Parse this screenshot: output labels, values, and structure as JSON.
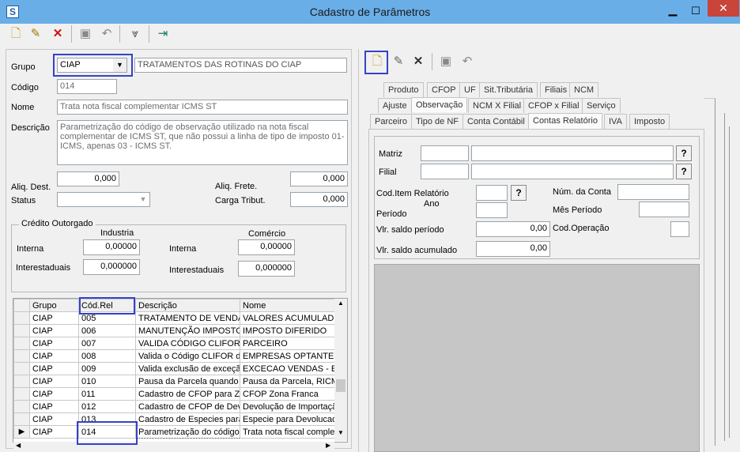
{
  "window": {
    "title": "Cadastro de Parâmetros"
  },
  "toolbar": {
    "buttons": [
      {
        "name": "new-icon",
        "glyph": "🗋"
      },
      {
        "name": "edit-icon",
        "glyph": "✎"
      },
      {
        "name": "delete-icon",
        "glyph": "✕"
      },
      {
        "name": "save-icon",
        "glyph": "💾"
      },
      {
        "name": "undo-icon",
        "glyph": "↶"
      },
      {
        "name": "filter-icon",
        "glyph": "⌨"
      },
      {
        "name": "exit-icon",
        "glyph": "⇥"
      }
    ]
  },
  "form": {
    "grupo_label": "Grupo",
    "grupo_value": "CIAP",
    "grupo_desc": "TRATAMENTOS DAS ROTINAS DO CIAP",
    "codigo_label": "Código",
    "codigo_value": "014",
    "nome_label": "Nome",
    "nome_value": "Trata nota fiscal complementar ICMS ST",
    "descricao_label": "Descrição",
    "descricao_value": "Parametrização do código de observação utilizado na nota fiscal complementar de ICMS ST, que não possui a linha de tipo de imposto 01-ICMS, apenas 03 - ICMS ST.",
    "aliq_dest_label": "Aliq. Dest.",
    "aliq_dest_value": "0,000",
    "aliq_frete_label": "Aliq. Frete.",
    "aliq_frete_value": "0,000",
    "status_label": "Status",
    "carga_label": "Carga Tribut.",
    "carga_value": "0,000",
    "credito": {
      "title": "Crédito Outorgado",
      "industria": "Industria",
      "comercio": "Comércio",
      "interna": "Interna",
      "interestaduais": "Interestaduais",
      "ind_interna": "0,00000",
      "ind_inter": "0,000000",
      "com_interna": "0,00000",
      "com_inter": "0,000000"
    }
  },
  "grid": {
    "columns": [
      "Grupo",
      "Cód.Rel",
      "Descrição",
      "Nome"
    ],
    "rows": [
      [
        "CIAP",
        "005",
        "TRATAMENTO DE VENDAS",
        "VALORES ACUMULADOS"
      ],
      [
        "CIAP",
        "006",
        "MANUTENÇÃO IMPOSTO D",
        "IMPOSTO DIFERIDO"
      ],
      [
        "CIAP",
        "007",
        "VALIDA CÓDIGO CLIFOR E",
        "PARCEIRO"
      ],
      [
        "CIAP",
        "008",
        "Valida o Código CLIFOR de",
        "EMPRESAS OPTANTES P"
      ],
      [
        "CIAP",
        "009",
        "Valida exclusão de exceçã",
        "EXCECAO VENDAS - EXC"
      ],
      [
        "CIAP",
        "010",
        "Pausa da Parcela quando r",
        "Pausa da Parcela, RICMS"
      ],
      [
        "CIAP",
        "011",
        "Cadastro de CFOP para Zo",
        "CFOP Zona Franca"
      ],
      [
        "CIAP",
        "012",
        "Cadastro de CFOP de Dev",
        "Devolução de Importaçã"
      ],
      [
        "CIAP",
        "013",
        "Cadastro de Especies para",
        "Especie para Devolucao"
      ],
      [
        "CIAP",
        "014",
        "Parametrização do código",
        "Trata nota fiscal comple"
      ]
    ]
  },
  "right": {
    "tabs_row1": [
      "Produto",
      "CFOP",
      "UF",
      "Sit.Tributária",
      "Filiais",
      "NCM"
    ],
    "tabs_row2": [
      "Ajuste",
      "Observação",
      "NCM X Filial",
      "CFOP x Filial",
      "Serviço"
    ],
    "tabs_row3": [
      "Parceiro",
      "Tipo de NF",
      "Conta Contábil",
      "Contas Relatório",
      "IVA",
      "Imposto"
    ],
    "matriz_label": "Matriz",
    "filial_label": "Filial",
    "cod_item_label": "Cod.Item Relatório",
    "ano_label": "Ano",
    "periodo_label": "Período",
    "num_conta_label": "Núm. da Conta",
    "mes_periodo_label": "Mês Período",
    "saldo_periodo_label": "Vlr. saldo período",
    "saldo_periodo_value": "0,00",
    "cod_operacao_label": "Cod.Operação",
    "saldo_acum_label": "Vlr. saldo acumulado",
    "saldo_acum_value": "0,00",
    "help": "?"
  }
}
